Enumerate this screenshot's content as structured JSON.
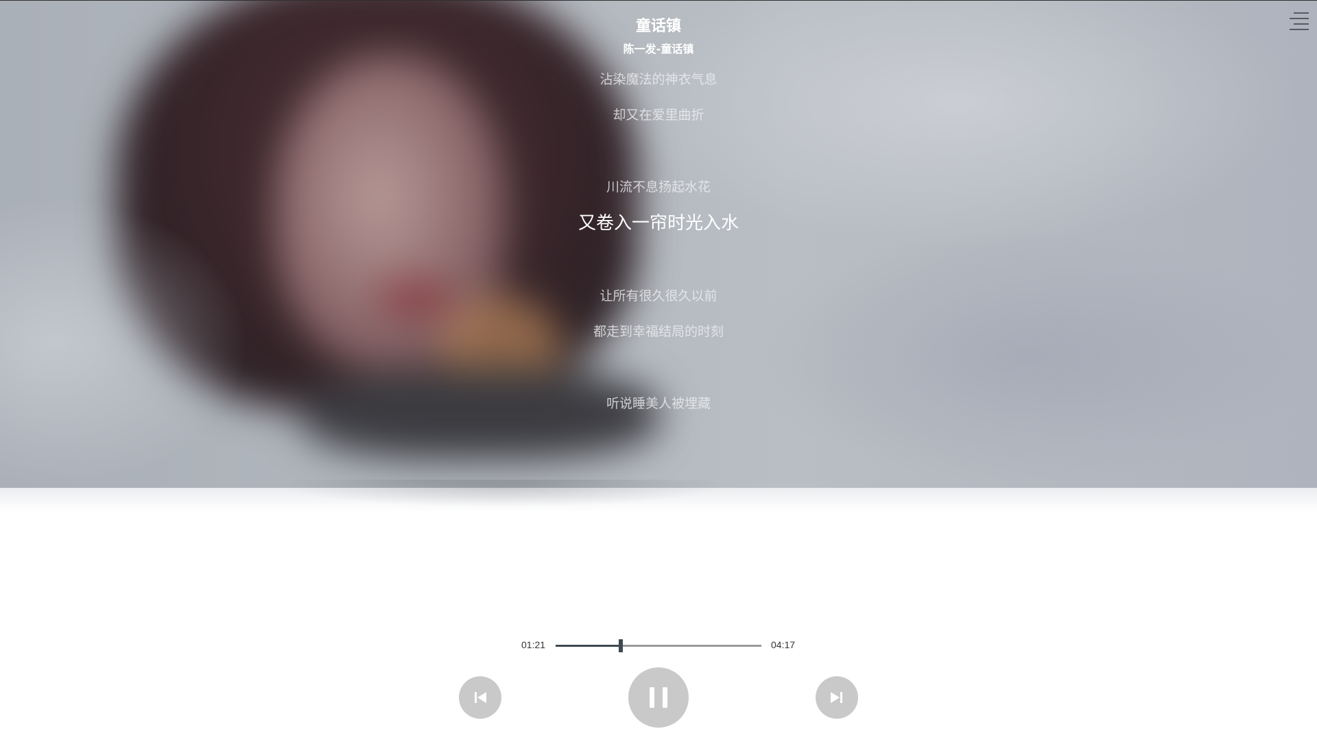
{
  "header": {
    "title": "童话镇",
    "subtitle": "陈一发-童话镇"
  },
  "menu": {
    "icon": "hamburger-menu-icon"
  },
  "lyrics": [
    {
      "text": "沾染魔法的神衣气息",
      "active": false
    },
    {
      "text": "却又在爱里曲折",
      "active": false
    },
    {
      "text": "",
      "active": false
    },
    {
      "text": "川流不息扬起水花",
      "active": false
    },
    {
      "text": "又卷入一帘时光入水",
      "active": true
    },
    {
      "text": "",
      "active": false
    },
    {
      "text": "让所有很久很久以前",
      "active": false
    },
    {
      "text": "都走到幸福结局的时刻",
      "active": false
    },
    {
      "text": "",
      "active": false
    },
    {
      "text": "听说睡美人被埋藏",
      "active": false
    }
  ],
  "player": {
    "current_time": "01:21",
    "total_time": "04:17",
    "progress": 0.315,
    "state": "playing"
  },
  "controls": {
    "prev_icon": "skip-previous-icon",
    "play_pause_icon": "pause-icon",
    "next_icon": "skip-next-icon"
  },
  "colors": {
    "accent": "#3e4a50",
    "track": "#9a9a9a",
    "control_bg": "#c9c9c9",
    "control_icon": "#ffffff",
    "lyric_active": "#ffffff"
  }
}
